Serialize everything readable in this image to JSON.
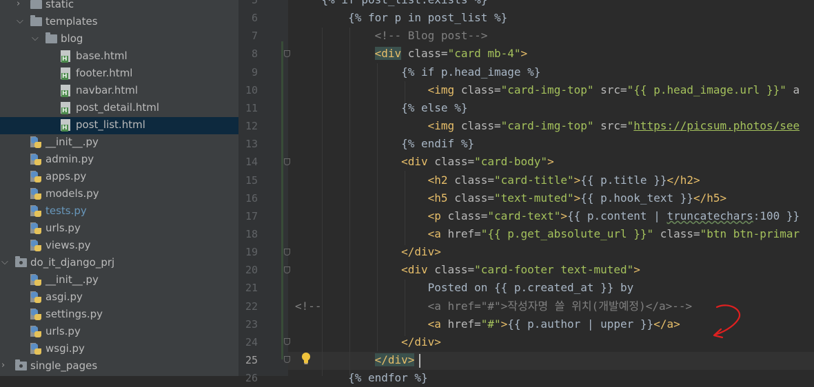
{
  "project_tree": [
    {
      "label": "static",
      "kind": "folder",
      "depth": 1,
      "expanded": false
    },
    {
      "label": "templates",
      "kind": "folder",
      "depth": 1,
      "expanded": true
    },
    {
      "label": "blog",
      "kind": "folder",
      "depth": 2,
      "expanded": true
    },
    {
      "label": "base.html",
      "kind": "html",
      "depth": 3
    },
    {
      "label": "footer.html",
      "kind": "html",
      "depth": 3
    },
    {
      "label": "navbar.html",
      "kind": "html",
      "depth": 3
    },
    {
      "label": "post_detail.html",
      "kind": "html",
      "depth": 3
    },
    {
      "label": "post_list.html",
      "kind": "html",
      "depth": 3,
      "selected": true
    },
    {
      "label": "__init__.py",
      "kind": "py",
      "depth": 1
    },
    {
      "label": "admin.py",
      "kind": "py",
      "depth": 1
    },
    {
      "label": "apps.py",
      "kind": "py",
      "depth": 1
    },
    {
      "label": "models.py",
      "kind": "py",
      "depth": 1
    },
    {
      "label": "tests.py",
      "kind": "py",
      "depth": 1,
      "color": "#6897bb"
    },
    {
      "label": "urls.py",
      "kind": "py",
      "depth": 1
    },
    {
      "label": "views.py",
      "kind": "py",
      "depth": 1
    },
    {
      "label": "do_it_django_prj",
      "kind": "package",
      "depth": 0,
      "expanded": true
    },
    {
      "label": "__init__.py",
      "kind": "py",
      "depth": 1
    },
    {
      "label": "asgi.py",
      "kind": "py",
      "depth": 1
    },
    {
      "label": "settings.py",
      "kind": "py",
      "depth": 1
    },
    {
      "label": "urls.py",
      "kind": "py",
      "depth": 1
    },
    {
      "label": "wsgi.py",
      "kind": "py",
      "depth": 1
    },
    {
      "label": "single_pages",
      "kind": "package",
      "depth": 0,
      "expanded": false
    }
  ],
  "editor": {
    "current_line": 25,
    "lines": [
      {
        "n": "5",
        "indent": 0,
        "seg": [
          [
            "t-tpl",
            "    {% if post_list.exists %}"
          ]
        ]
      },
      {
        "n": "6",
        "indent": 0,
        "seg": [
          [
            "t-tpl",
            "        {% for p in post_list %}"
          ]
        ]
      },
      {
        "n": "7",
        "indent": 0,
        "seg": [
          [
            "t-cmt",
            "            <!-- Blog post-->"
          ]
        ]
      },
      {
        "n": "8",
        "indent": 0,
        "seg": [
          [
            "t-tpl",
            "            "
          ],
          [
            "t-tag t-hl",
            "<div"
          ],
          [
            "t-attr",
            " class="
          ],
          [
            "t-val",
            "\"card mb-4\""
          ],
          [
            "t-tag",
            ">"
          ]
        ]
      },
      {
        "n": "9",
        "indent": 0,
        "seg": [
          [
            "t-tpl",
            "                {% if p.head_image %}"
          ]
        ]
      },
      {
        "n": "10",
        "indent": 0,
        "seg": [
          [
            "t-tpl",
            "                    "
          ],
          [
            "t-tag",
            "<img"
          ],
          [
            "t-attr",
            " class="
          ],
          [
            "t-val",
            "\"card-img-top\""
          ],
          [
            "t-attr",
            " src="
          ],
          [
            "t-val",
            "\"{{ p.head_image.url }}\""
          ],
          [
            "t-attr",
            " a"
          ]
        ]
      },
      {
        "n": "11",
        "indent": 0,
        "seg": [
          [
            "t-tpl",
            "                {% else %}"
          ]
        ]
      },
      {
        "n": "12",
        "indent": 0,
        "seg": [
          [
            "t-tpl",
            "                    "
          ],
          [
            "t-tag",
            "<img"
          ],
          [
            "t-attr",
            " class="
          ],
          [
            "t-val",
            "\"card-img-top\""
          ],
          [
            "t-attr",
            " src="
          ],
          [
            "t-val",
            "\""
          ],
          [
            "t-link",
            "https://picsum.photos/see"
          ]
        ]
      },
      {
        "n": "13",
        "indent": 0,
        "seg": [
          [
            "t-tpl",
            "                {% endif %}"
          ]
        ]
      },
      {
        "n": "14",
        "indent": 0,
        "seg": [
          [
            "t-tpl",
            "                "
          ],
          [
            "t-tag",
            "<div"
          ],
          [
            "t-attr",
            " class="
          ],
          [
            "t-val",
            "\"card-body\""
          ],
          [
            "t-tag",
            ">"
          ]
        ]
      },
      {
        "n": "15",
        "indent": 0,
        "seg": [
          [
            "t-tpl",
            "                    "
          ],
          [
            "t-tag",
            "<h2"
          ],
          [
            "t-attr",
            " class="
          ],
          [
            "t-val",
            "\"card-title\""
          ],
          [
            "t-tag",
            ">"
          ],
          [
            "t-tpl",
            "{{ p.title }}"
          ],
          [
            "t-tag",
            "</h2>"
          ]
        ]
      },
      {
        "n": "16",
        "indent": 0,
        "seg": [
          [
            "t-tpl",
            "                    "
          ],
          [
            "t-tag",
            "<h5"
          ],
          [
            "t-attr",
            " class="
          ],
          [
            "t-val",
            "\"text-muted\""
          ],
          [
            "t-tag",
            ">"
          ],
          [
            "t-tpl",
            "{{ p.hook_text }}"
          ],
          [
            "t-tag",
            "</h5>"
          ]
        ]
      },
      {
        "n": "17",
        "indent": 0,
        "seg": [
          [
            "t-tpl",
            "                    "
          ],
          [
            "t-tag",
            "<p"
          ],
          [
            "t-attr",
            " class="
          ],
          [
            "t-val",
            "\"card-text\""
          ],
          [
            "t-tag",
            ">"
          ],
          [
            "t-tpl",
            "{{ p.content | "
          ],
          [
            "t-tpl t-wavy",
            "truncatechars"
          ],
          [
            "t-tpl",
            ":100 }}"
          ]
        ]
      },
      {
        "n": "18",
        "indent": 0,
        "seg": [
          [
            "t-tpl",
            "                    "
          ],
          [
            "t-tag",
            "<a"
          ],
          [
            "t-attr",
            " href="
          ],
          [
            "t-val",
            "\"{{ p.get_absolute_url }}\""
          ],
          [
            "t-attr",
            " class="
          ],
          [
            "t-val",
            "\"btn btn-primar"
          ]
        ]
      },
      {
        "n": "19",
        "indent": 0,
        "seg": [
          [
            "t-tpl",
            "                "
          ],
          [
            "t-tag",
            "</div>"
          ]
        ]
      },
      {
        "n": "20",
        "indent": 0,
        "seg": [
          [
            "t-tpl",
            "                "
          ],
          [
            "t-tag",
            "<div"
          ],
          [
            "t-attr",
            " class="
          ],
          [
            "t-val",
            "\"card-footer text-muted\""
          ],
          [
            "t-tag",
            ">"
          ]
        ]
      },
      {
        "n": "21",
        "indent": 0,
        "seg": [
          [
            "t-tpl",
            "                    Posted on {{ p.created_at }} by"
          ]
        ]
      },
      {
        "n": "22",
        "indent": 0,
        "seg": [
          [
            "t-cmt",
            "<!--                "
          ],
          [
            "t-cmt",
            "<a href=\"#\">작성자명 쓸 위치(개발예정)</a>-->"
          ]
        ]
      },
      {
        "n": "23",
        "indent": 0,
        "seg": [
          [
            "t-tpl",
            "                    "
          ],
          [
            "t-tag",
            "<a"
          ],
          [
            "t-attr",
            " href="
          ],
          [
            "t-val",
            "\"#\""
          ],
          [
            "t-tag",
            ">"
          ],
          [
            "t-tpl",
            "{{ p.author | upper }}"
          ],
          [
            "t-tag",
            "</a>"
          ]
        ]
      },
      {
        "n": "24",
        "indent": 0,
        "seg": [
          [
            "t-tpl",
            "                "
          ],
          [
            "t-tag",
            "</div>"
          ]
        ]
      },
      {
        "n": "25",
        "indent": 0,
        "seg": [
          [
            "t-tpl",
            "            "
          ],
          [
            "t-tag t-hl",
            "</div>"
          ]
        ]
      },
      {
        "n": "26",
        "indent": 0,
        "seg": [
          [
            "t-tpl",
            "        {% endfor %}"
          ]
        ]
      }
    ]
  },
  "icons": {
    "folder": "folder-icon",
    "package": "package-folder-icon",
    "html": "html-file-icon",
    "py": "python-file-icon",
    "bulb": "lightbulb-icon",
    "annotation": "red-arrow-annotation"
  },
  "colors": {
    "tag": "#e8bf6a",
    "string": "#a5c25c",
    "comment": "#808080",
    "selection": "#0d293e",
    "annotation": "#e02020"
  }
}
